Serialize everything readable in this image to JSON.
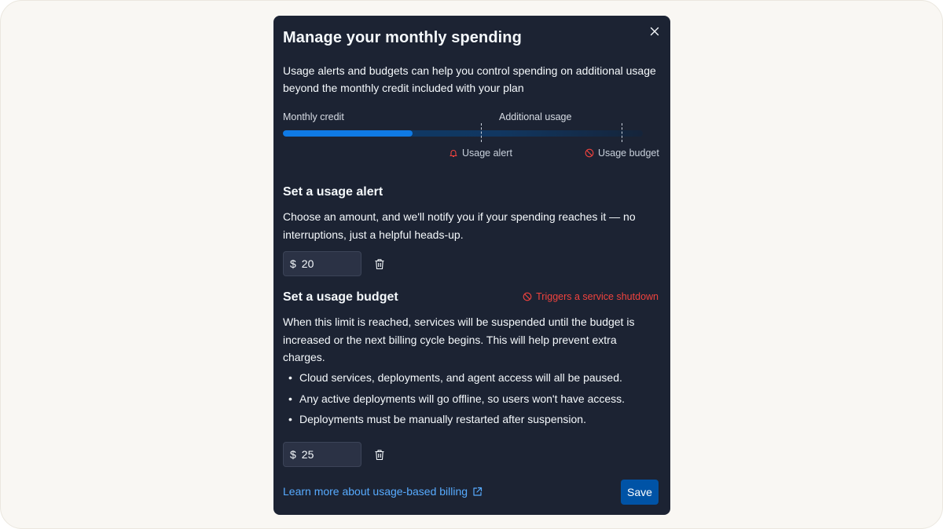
{
  "modal": {
    "title": "Manage your monthly spending",
    "description": "Usage alerts and budgets can help you control spending on additional usage beyond the monthly credit included with your plan"
  },
  "usage_bar": {
    "monthly_credit_label": "Monthly credit",
    "additional_usage_label": "Additional usage",
    "usage_alert_label": "Usage alert",
    "usage_budget_label": "Usage budget",
    "credit_fill_fraction": 0.36
  },
  "alert": {
    "heading": "Set a usage alert",
    "description": "Choose an amount, and we'll notify you if your spending reaches it — no interruptions, just a helpful heads-up.",
    "currency_symbol": "$",
    "amount": "20"
  },
  "budget": {
    "heading": "Set a usage budget",
    "warning": "Triggers a service shutdown",
    "description": "When this limit is reached, services will be suspended until the budget is increased or the next billing cycle begins. This will help prevent extra charges.",
    "bullets": [
      "Cloud services, deployments, and agent access will all be paused.",
      "Any active deployments will go offline, so users won't have access.",
      "Deployments must be manually restarted after suspension."
    ],
    "currency_symbol": "$",
    "amount": "25"
  },
  "footer": {
    "learn_more_label": "Learn more about usage-based billing",
    "save_label": "Save"
  },
  "colors": {
    "modal_bg": "#1c2333",
    "accent_blue": "#0f7ae5",
    "link_blue": "#57abff",
    "danger_red": "#f0433e",
    "save_button": "#0053a6"
  },
  "icons": {
    "close": "close-icon",
    "alert": "bell-icon",
    "budget": "prohibit-icon",
    "delete": "trash-icon",
    "external": "external-link-icon"
  }
}
